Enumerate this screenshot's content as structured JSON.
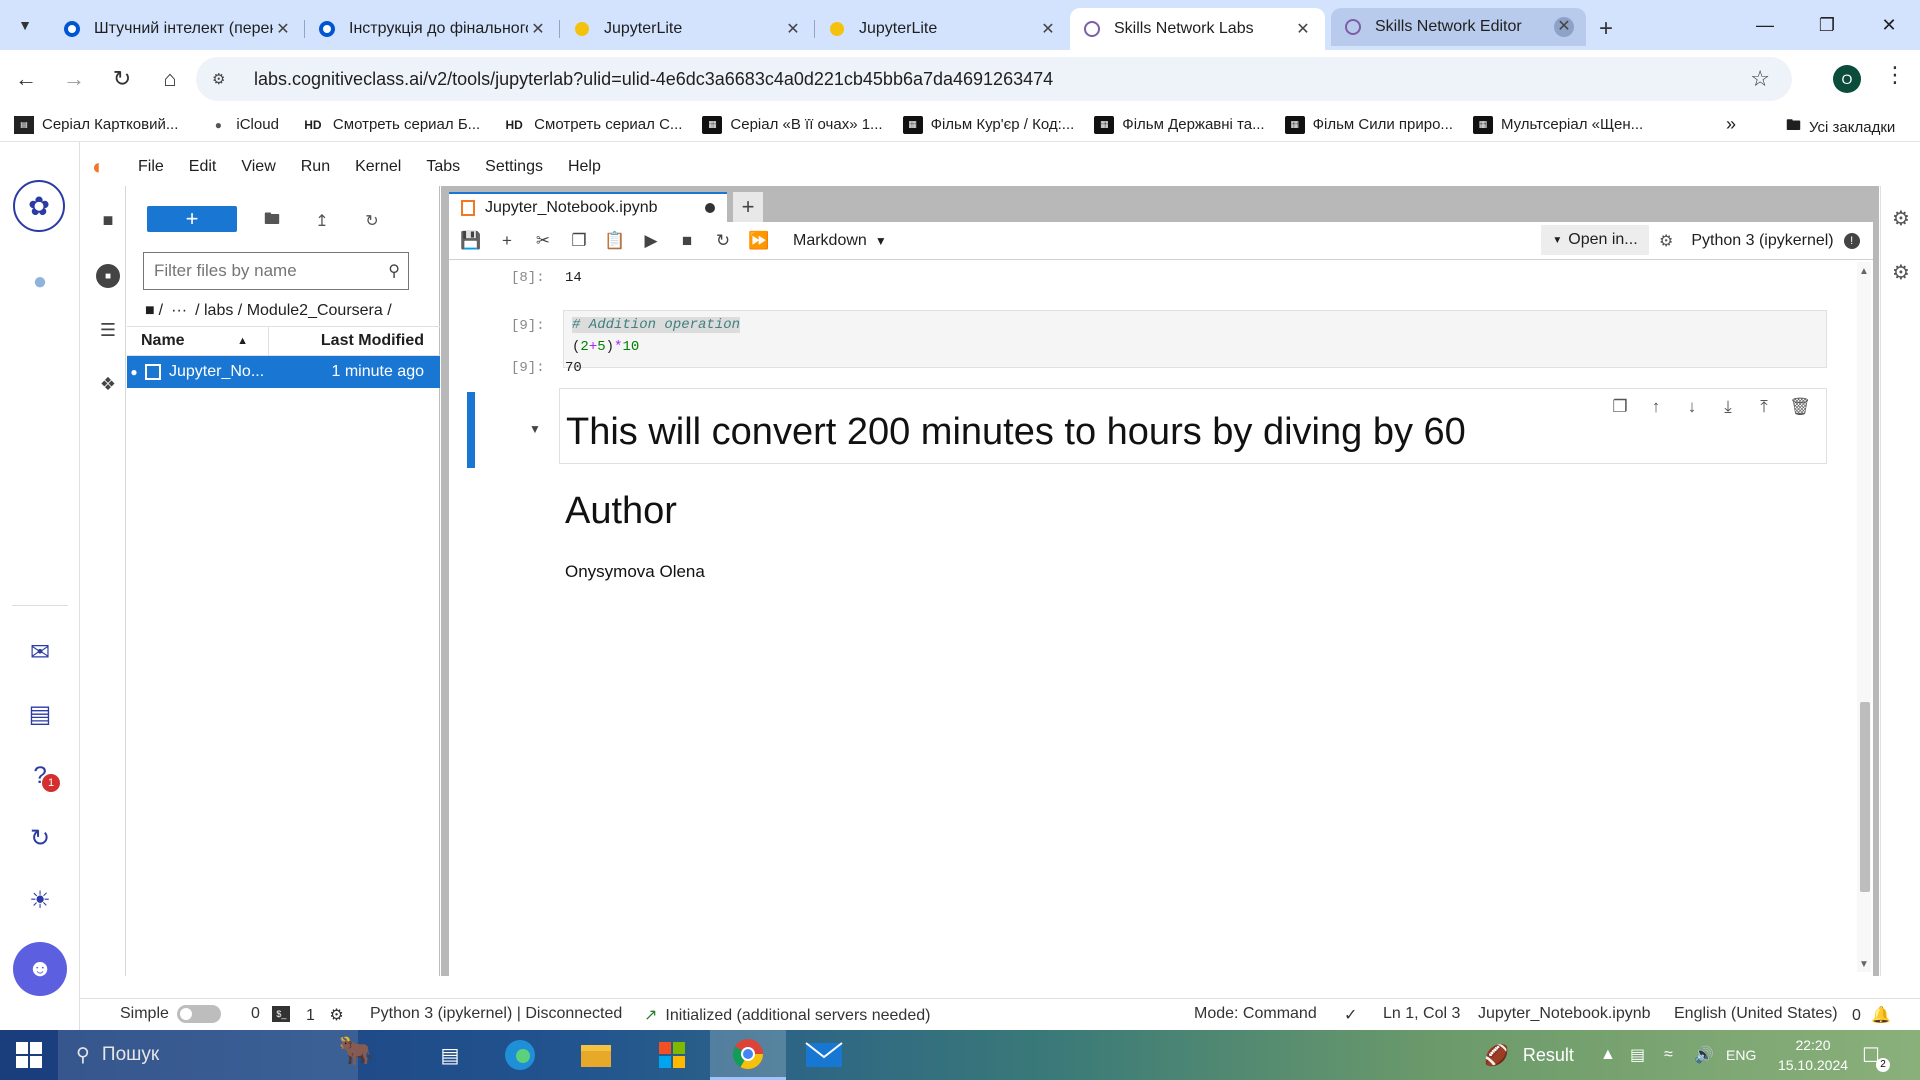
{
  "browser": {
    "tabs": [
      {
        "title": "Штучний інтелект (переке",
        "icon": "coursera-icon"
      },
      {
        "title": "Інструкція до фінального",
        "icon": "coursera-icon"
      },
      {
        "title": "JupyterLite",
        "icon": "jupyterlite-icon"
      },
      {
        "title": "JupyterLite",
        "icon": "jupyterlite-icon"
      },
      {
        "title": "Skills Network Labs",
        "icon": "skills-network-icon",
        "active": true
      },
      {
        "title": "Skills Network Editor",
        "icon": "skills-network-icon"
      }
    ],
    "url": "labs.cognitiveclass.ai/v2/tools/jupyterlab?ulid=ulid-4e6dc3a6683c4a0d221cb45bb6a7da4691263474",
    "profile_initial": "O",
    "bookmarks": [
      {
        "label": "Серіал Картковий...",
        "icon": "bookmark-favicon"
      },
      {
        "label": "iCloud",
        "icon": "apple-icon"
      },
      {
        "label": "Смотреть сериал Б...",
        "icon": "hd-icon"
      },
      {
        "label": "Смотреть сериал С...",
        "icon": "hd-icon"
      },
      {
        "label": "Серіал «В її очах» 1...",
        "icon": "film-icon"
      },
      {
        "label": "Фільм Кур'єр / Код:...",
        "icon": "film-icon"
      },
      {
        "label": "Фільм Державні та...",
        "icon": "film-icon"
      },
      {
        "label": "Фільм Сили приро...",
        "icon": "film-icon"
      },
      {
        "label": "Мультсеріал «Щен...",
        "icon": "film-icon"
      }
    ],
    "bookmarks_more": "»",
    "all_bookmarks": "Усі закладки",
    "hd_label": "HD"
  },
  "lab": {
    "menu": [
      "File",
      "Edit",
      "View",
      "Run",
      "Kernel",
      "Tabs",
      "Settings",
      "Help"
    ],
    "notification_count": "1",
    "filebrowser": {
      "filter_placeholder": "Filter files by name",
      "breadcrumb": [
        "/",
        "···",
        "/ labs / Module2_Coursera /"
      ],
      "col_name": "Name",
      "col_modified": "Last Modified",
      "files": [
        {
          "name": "Jupyter_No...",
          "modified": "1 minute ago"
        }
      ]
    },
    "doc_tab": "Jupyter_Notebook.ipynb",
    "toolbar": {
      "cell_type": "Markdown",
      "open_in": "Open in...",
      "kernel": "Python 3 (ipykernel)"
    },
    "cells": {
      "out8_prompt": "[8]:",
      "out8_value": "14",
      "in9_prompt": "[9]:",
      "in9_comment": "# Addition operation",
      "in9_code": {
        "lp": "(",
        "a": "2",
        "plus": "+",
        "b": "5",
        "rp": ")",
        "mul": "*",
        "c": "10"
      },
      "out9_prompt": "[9]:",
      "out9_value": "70",
      "markdown_heading": "This will convert 200 minutes to hours by diving by 60",
      "author_heading": "Author",
      "author_name": "Onysymova Olena"
    },
    "status": {
      "mode_simple": "Simple",
      "terminals": "0",
      "kernels": "1",
      "kernel_status": "Python 3 (ipykernel) | Disconnected",
      "init": "Initialized (additional servers needed)",
      "mode": "Mode: Command",
      "cursor": "Ln 1, Col 3",
      "filename": "Jupyter_Notebook.ipynb",
      "language": "English (United States)",
      "notifications": "0"
    }
  },
  "taskbar": {
    "search_placeholder": "Пошук",
    "weather": "Result",
    "lang": "ENG",
    "time": "22:20",
    "date": "15.10.2024",
    "notif_count": "2"
  },
  "colors": {
    "accent": "#1976d2",
    "tabstrip": "#d3e3fd",
    "jupyter_orange": "#f37626"
  }
}
